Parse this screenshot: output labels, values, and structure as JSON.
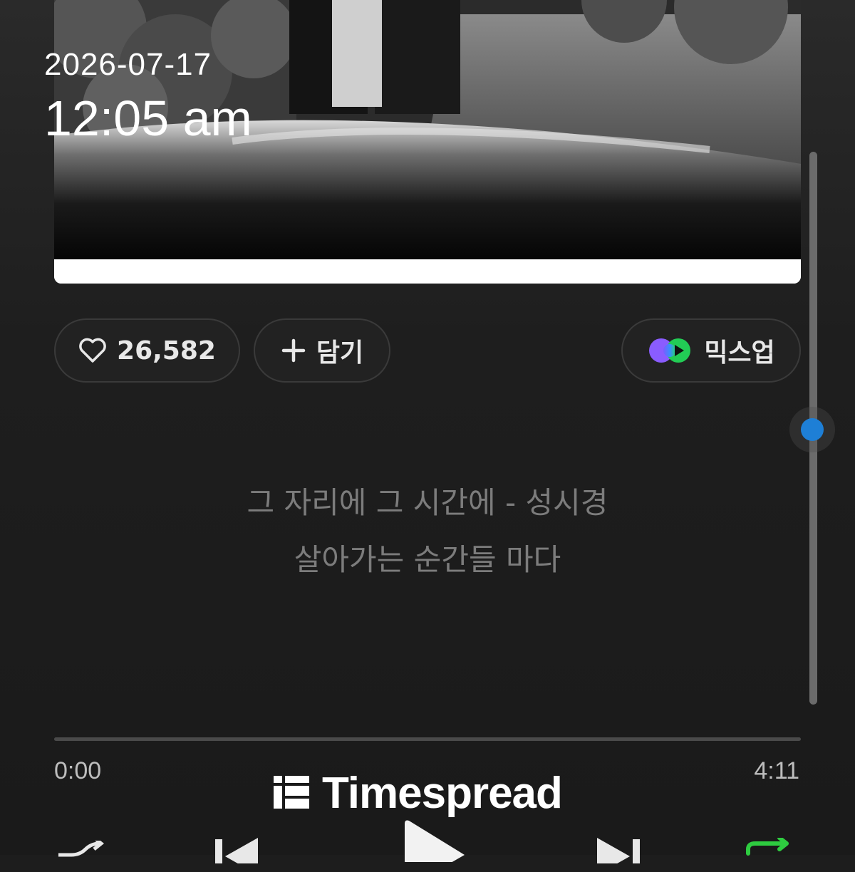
{
  "watermark": {
    "date": "2026-07-17",
    "time": "12:05 am",
    "brand": "Timespread"
  },
  "actions": {
    "like_count": "26,582",
    "add_label": "담기",
    "mixup_label": "믹스업"
  },
  "lyrics": {
    "line1": "그 자리에 그 시간에 - 성시경",
    "line2": "살아가는 순간들 마다"
  },
  "player": {
    "current_time": "0:00",
    "total_time": "4:11",
    "progress": 0,
    "repeat_color": "#2ecc40"
  },
  "icons": [
    "heart-icon",
    "plus-icon",
    "mixup-icon",
    "shuffle-icon",
    "previous-icon",
    "play-icon",
    "next-icon",
    "repeat-icon",
    "timespread-logo-icon"
  ],
  "colors": {
    "background": "#1d1d1d",
    "accent_blue": "#1e7fd6",
    "repeat_green": "#2ecc40"
  }
}
